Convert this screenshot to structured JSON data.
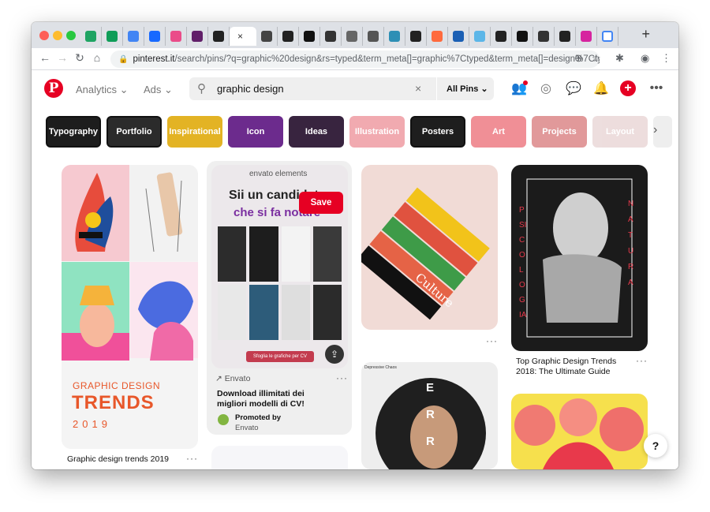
{
  "browser": {
    "tab_favicons": [
      "google-drive-icon",
      "google-sheets-icon",
      "google-docs-icon",
      "behance-icon",
      "dribbble-icon",
      "slack-icon",
      "site-icon",
      "pinterest-tab-icon",
      "site-icon",
      "site-icon",
      "site-icon",
      "site-icon",
      "site-icon",
      "site-icon",
      "site-icon",
      "site-icon",
      "site-icon",
      "site-icon",
      "site-icon",
      "site-icon",
      "site-icon",
      "site-icon",
      "site-icon",
      "instagram-icon",
      "google-icon"
    ],
    "active_tab_close": "×",
    "new_tab": "+",
    "url_host": "pinterest.it",
    "url_path": "/search/pins/?q=graphic%20design&rs=typed&term_meta[]=graphic%7Ctyped&term_meta[]=design%7Cty..."
  },
  "header": {
    "logo": "P",
    "nav_analytics": "Analytics ⌄",
    "nav_ads": "Ads ⌄",
    "search_value": "graphic design",
    "search_clear": "×",
    "search_filter": "All Pins ⌄"
  },
  "chips": [
    {
      "label": "Typography",
      "color": "#1d1d1d"
    },
    {
      "label": "Portfolio",
      "color": "#2b2b2b"
    },
    {
      "label": "Inspirational",
      "color": "#e3b324"
    },
    {
      "label": "Icon",
      "color": "#6c2b8d"
    },
    {
      "label": "Ideas",
      "color": "#38243f"
    },
    {
      "label": "Illustration",
      "color": "#f1aab0"
    },
    {
      "label": "Posters",
      "color": "#1e1e1e"
    },
    {
      "label": "Art",
      "color": "#f08f96"
    },
    {
      "label": "Projects",
      "color": "#e1999a"
    },
    {
      "label": "Layout",
      "color": "#ead8d8"
    }
  ],
  "pins": {
    "pin1": {
      "title": "Graphic design trends 2019",
      "line1": "GRAPHIC DESIGN",
      "line2": "TRENDS",
      "line3": "2019"
    },
    "pin2": {
      "brand": "envato elements",
      "headline1": "Sii un candidato",
      "headline2": "che si fa notare",
      "cta": "Sfoglia le grafiche per CV",
      "save": "Save",
      "source": "Envato",
      "title": "Download illimitati dei migliori modelli di CV!",
      "promoted_by": "Promoted by",
      "promoter": "Envato"
    },
    "pin3": {
      "word": "Culture"
    },
    "pin4": {
      "title": "Top Graphic Design Trends 2018: The Ultimate Guide",
      "side_left": "PSICOLOGIA",
      "side_right": "NATURA"
    },
    "pin5": {
      "letters": [
        "E",
        "R",
        "R"
      ],
      "caption": "Depressive Chaos"
    }
  },
  "help": "?",
  "more_dots": "···"
}
